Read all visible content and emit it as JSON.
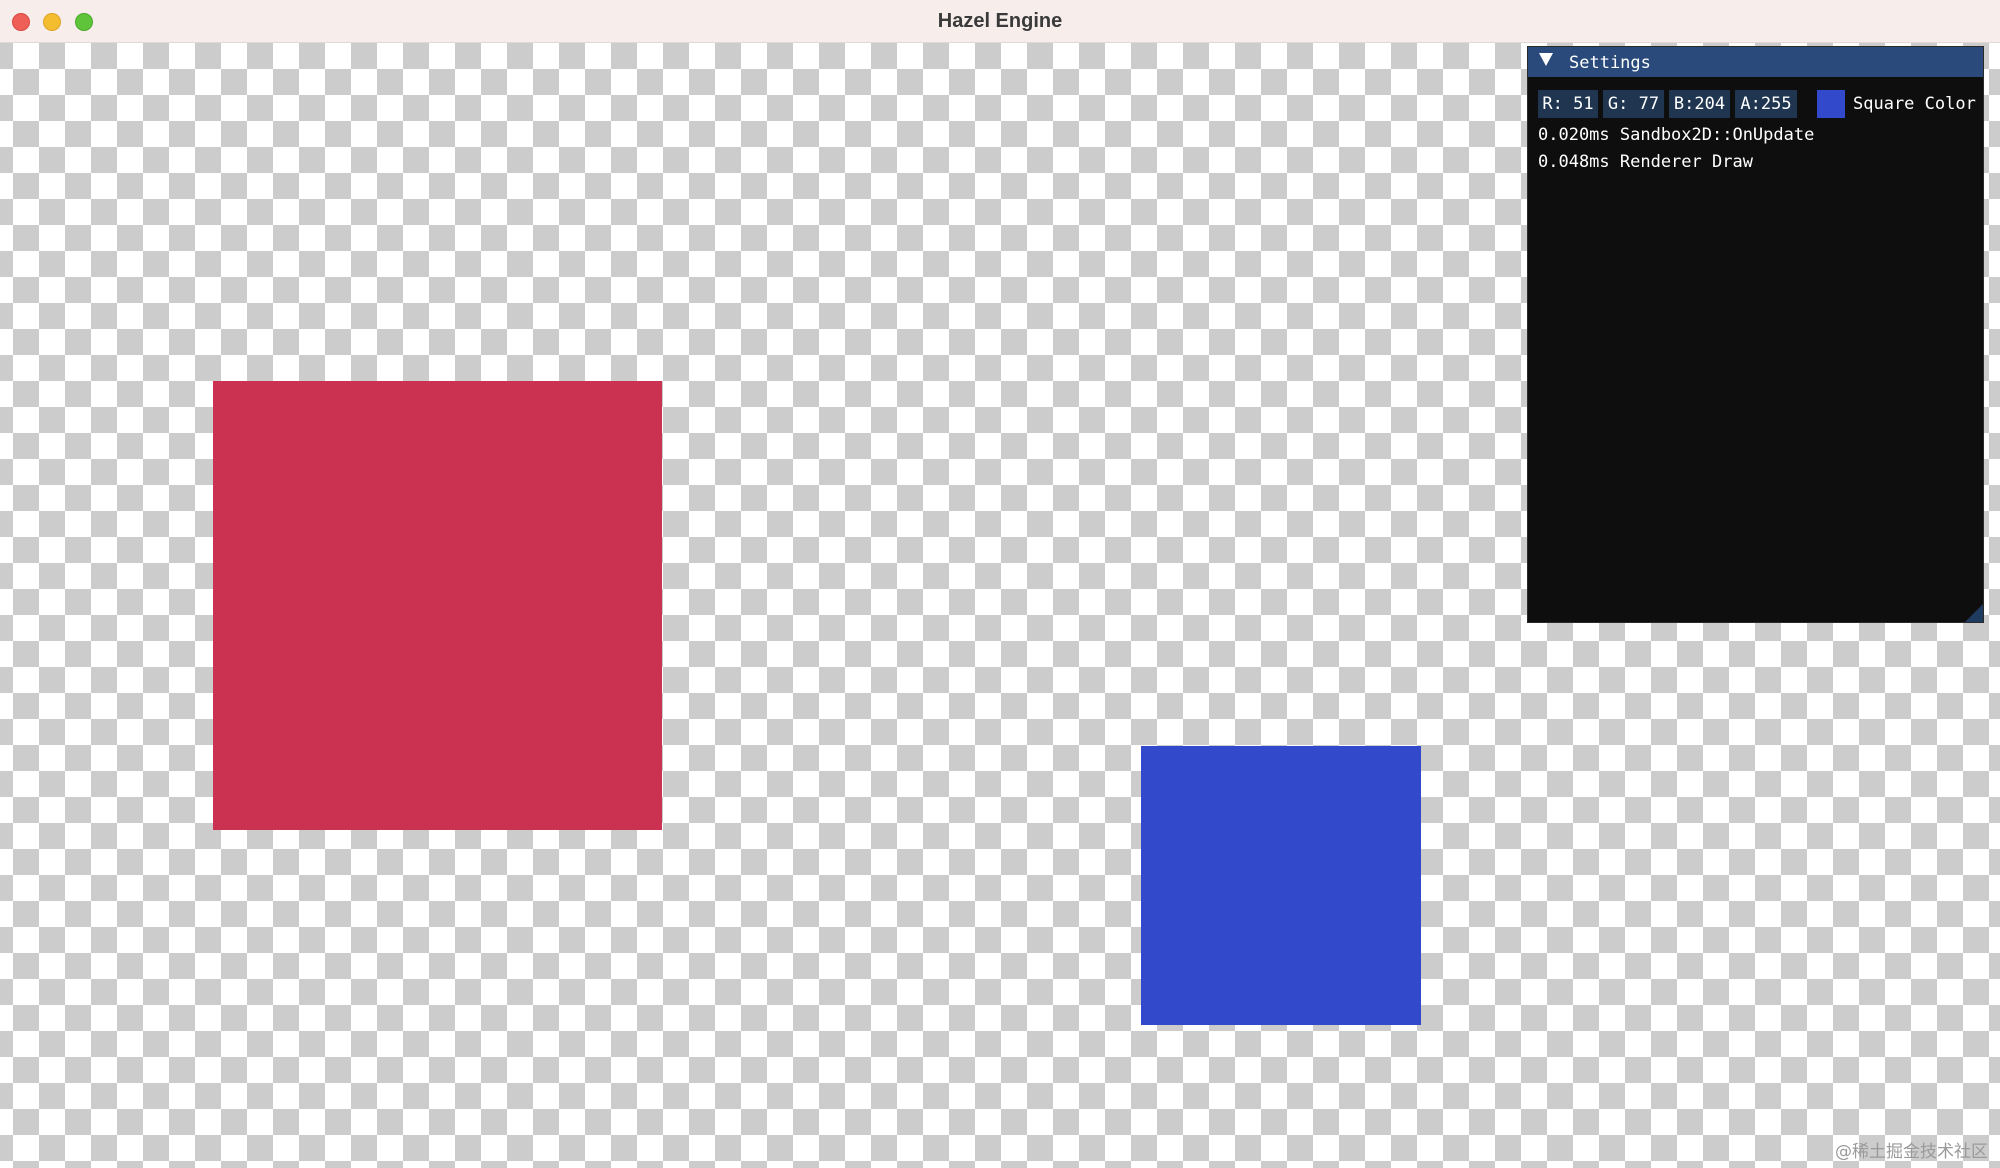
{
  "window": {
    "title": "Hazel Engine",
    "controls": [
      "close",
      "minimize",
      "zoom"
    ]
  },
  "scene": {
    "background": "checkerboard",
    "red_quad_color": "#cb3150",
    "blue_quad_color": "#3349cc"
  },
  "settings_panel": {
    "title": "Settings",
    "collapse_icon": "triangle-down-icon",
    "color_edit": {
      "r_label": "R: 51",
      "g_label": "G: 77",
      "b_label": "B:204",
      "a_label": "A:255",
      "swatch_color": "#3349cc",
      "label": "Square Color"
    },
    "stats": [
      "0.020ms Sandbox2D::OnUpdate",
      "0.048ms Renderer Draw"
    ]
  },
  "watermark": "@稀土掘金技术社区"
}
